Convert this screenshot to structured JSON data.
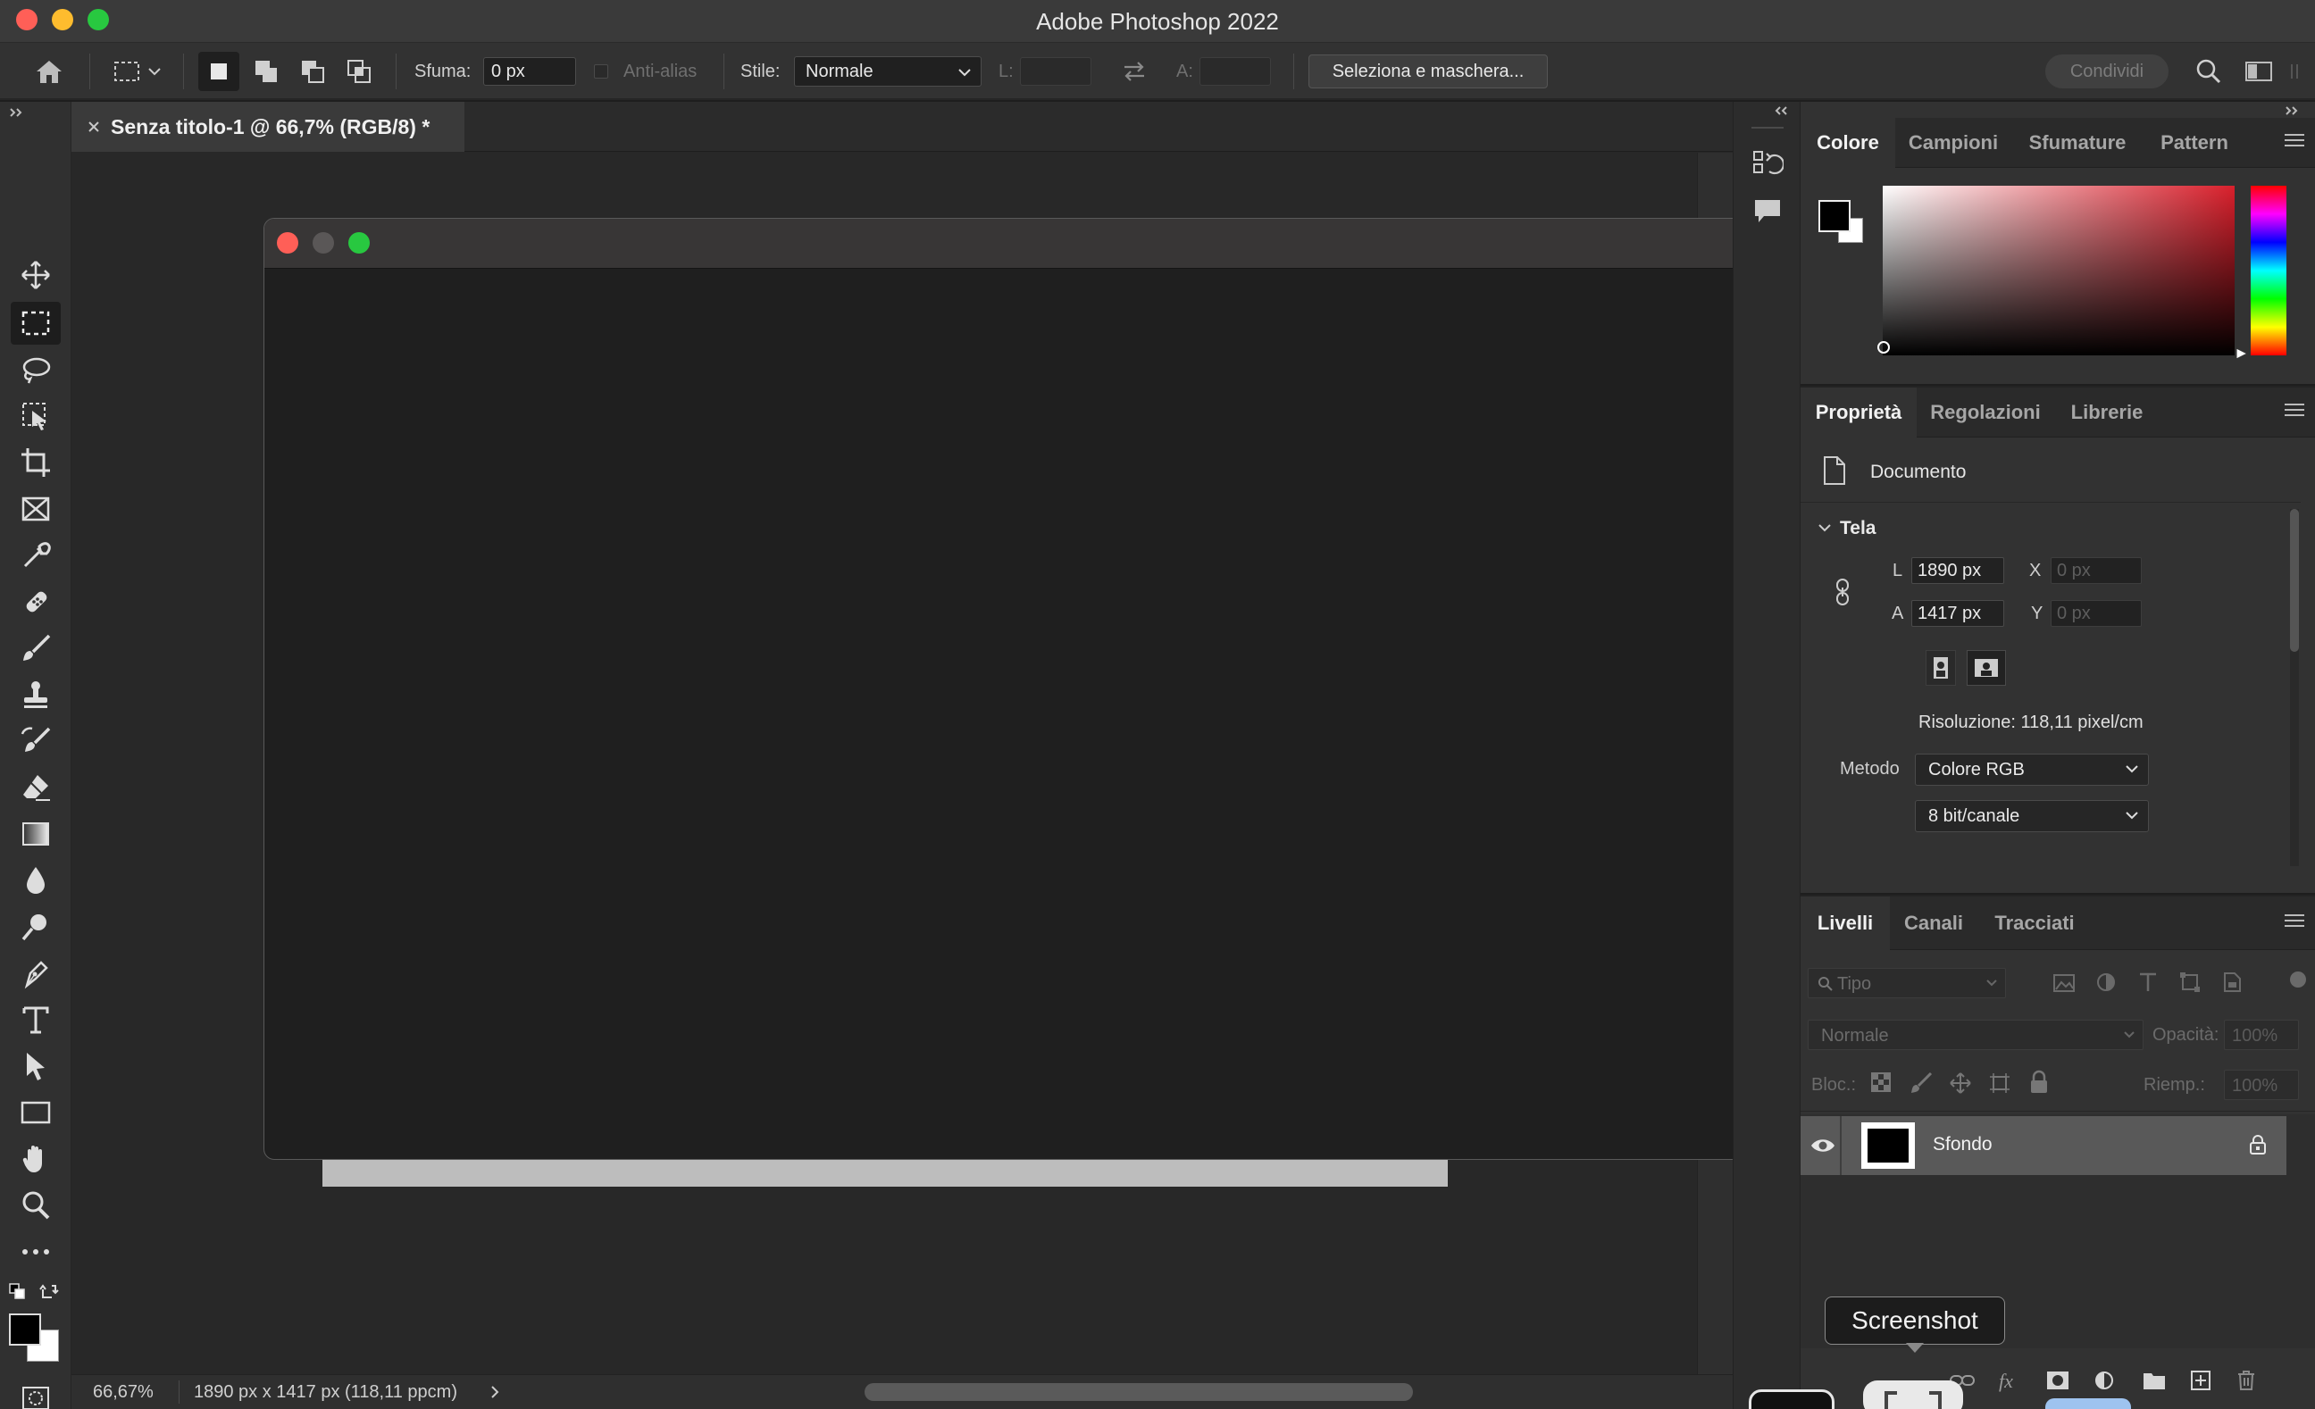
{
  "app": {
    "title": "Adobe Photoshop 2022"
  },
  "options_bar": {
    "feather_label": "Sfuma:",
    "feather_value": "0 px",
    "antialias_label": "Anti-alias",
    "style_label": "Stile:",
    "style_value": "Normale",
    "width_label": "L:",
    "height_label": "A:",
    "select_mask_button": "Seleziona e maschera...",
    "share_button": "Condividi"
  },
  "document": {
    "tab_title": "Senza titolo-1 @ 66,7% (RGB/8) *",
    "zoom": "66,67%",
    "info": "1890 px x 1417 px (118,11 ppcm)"
  },
  "color_panel": {
    "tabs": [
      "Colore",
      "Campioni",
      "Sfumature",
      "Pattern"
    ],
    "foreground": "#000000",
    "background": "#ffffff",
    "hue_accent": "#d9202c"
  },
  "properties_panel": {
    "tabs": [
      "Proprietà",
      "Regolazioni",
      "Librerie"
    ],
    "doc_label": "Documento",
    "section": "Tela",
    "width_label": "L",
    "width_value": "1890 px",
    "height_label": "A",
    "height_value": "1417 px",
    "x_label": "X",
    "x_placeholder": "0 px",
    "y_label": "Y",
    "y_placeholder": "0 px",
    "resolution": "Risoluzione: 118,11 pixel/cm",
    "mode_label": "Metodo",
    "mode_value": "Colore RGB",
    "depth_value": "8 bit/canale"
  },
  "layers_panel": {
    "tabs": [
      "Livelli",
      "Canali",
      "Tracciati"
    ],
    "filter_placeholder": "Tipo",
    "blend_mode": "Normale",
    "opacity_label": "Opacità:",
    "opacity_value": "100%",
    "lock_label": "Bloc.:",
    "fill_label": "Riemp.:",
    "fill_value": "100%",
    "layers": [
      {
        "name": "Sfondo",
        "visible": true,
        "locked": true
      }
    ],
    "fx_label": "fx"
  },
  "tooltip": {
    "text": "Screenshot"
  }
}
